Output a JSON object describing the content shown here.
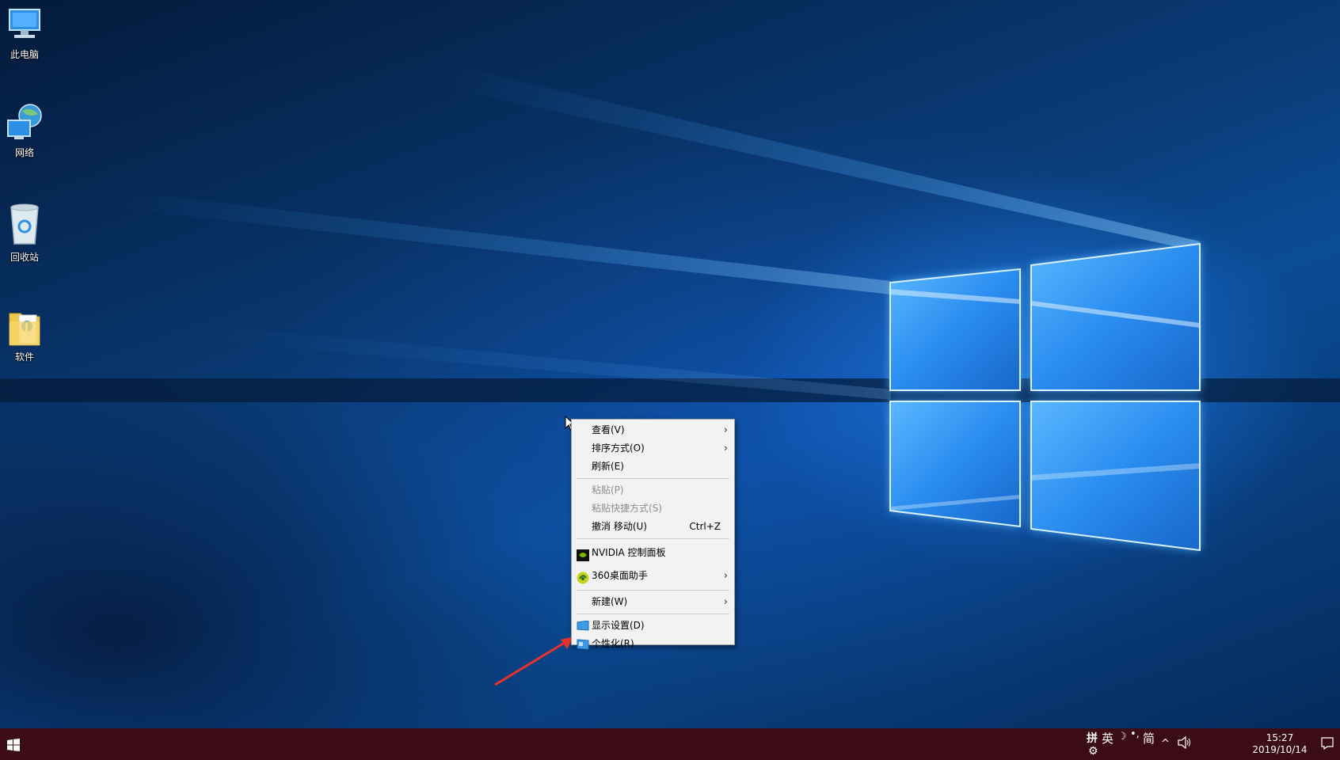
{
  "desktop_icons": [
    {
      "label": "此电脑",
      "icon": "this-pc-icon"
    },
    {
      "label": "网络",
      "icon": "network-icon"
    },
    {
      "label": "回收站",
      "icon": "recycle-bin-icon"
    },
    {
      "label": "软件",
      "icon": "folder-icon"
    }
  ],
  "context_menu": {
    "items": {
      "view": "查看(V)",
      "sort": "排序方式(O)",
      "refresh": "刷新(E)",
      "paste": "粘贴(P)",
      "paste_shortcut": "粘贴快捷方式(S)",
      "undo_move": "撤消 移动(U)",
      "undo_shortcut": "Ctrl+Z",
      "nvidia": "NVIDIA 控制面板",
      "desktop_360": "360桌面助手",
      "new": "新建(W)",
      "display_settings": "显示设置(D)",
      "personalize": "个性化(R)"
    },
    "submenu_arrow": "›"
  },
  "taskbar": {
    "ime_mode": "拼",
    "language": "英",
    "ime_moon": "☽",
    "ime_punct": "•,",
    "ime_simplified": "简",
    "tray_chevron": "^",
    "volume_icon": "speaker-icon",
    "time": "15:27",
    "date": "2019/10/14"
  },
  "colors": {
    "taskbar": "#3c0c16",
    "menu_bg": "#f2f2f2",
    "annotation_arrow": "#e8322c",
    "wallpaper_blue": "#1e90ff"
  }
}
